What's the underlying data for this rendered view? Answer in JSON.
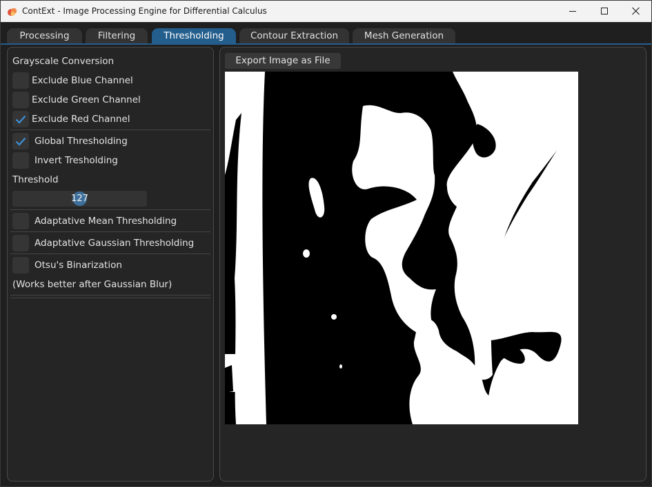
{
  "window": {
    "title": "ContExt - Image Processing Engine for Differential Calculus",
    "icon": "app-logo-icon",
    "controls": [
      "minimize-icon",
      "maximize-icon",
      "close-icon"
    ]
  },
  "tabs": [
    {
      "label": "Processing",
      "active": false
    },
    {
      "label": "Filtering",
      "active": false
    },
    {
      "label": "Thresholding",
      "active": true
    },
    {
      "label": "Contour Extraction",
      "active": false
    },
    {
      "label": "Mesh Generation",
      "active": false
    }
  ],
  "left_panel": {
    "grayscale": {
      "heading": "Grayscale Conversion",
      "options": [
        {
          "label": "Exclude Blue Channel",
          "checked": false
        },
        {
          "label": "Exclude Green Channel",
          "checked": false
        },
        {
          "label": "Exclude Red Channel",
          "checked": true
        }
      ]
    },
    "global": {
      "label": "Global Thresholding",
      "checked": true,
      "invert_label": "Invert Tresholding",
      "invert_checked": false,
      "threshold_label": "Threshold",
      "threshold_value": "127"
    },
    "adaptive_mean": {
      "label": "Adaptative Mean Thresholding",
      "checked": false
    },
    "adaptive_gaussian": {
      "label": "Adaptative Gaussian Thresholding",
      "checked": false
    },
    "otsu": {
      "label": "Otsu's Binarization",
      "checked": false,
      "note": "(Works better after Gaussian Blur)"
    }
  },
  "right_panel": {
    "export_label": "Export Image as File"
  },
  "colors": {
    "accent": "#245e8d",
    "tab_inactive": "#333333",
    "panel_bg": "#252525",
    "check": "#3d8fd6"
  }
}
